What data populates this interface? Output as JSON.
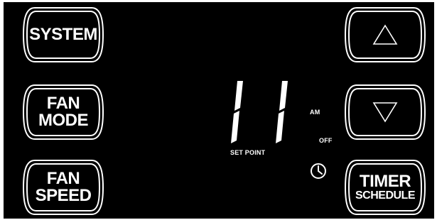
{
  "buttons": {
    "system": {
      "line1": "SYSTEM"
    },
    "fan_mode": {
      "line1": "FAN",
      "line2": "MODE"
    },
    "fan_speed": {
      "line1": "FAN",
      "line2": "SPEED"
    },
    "up": {
      "icon": "up-triangle-icon"
    },
    "down": {
      "icon": "down-triangle-icon"
    },
    "timer_schedule": {
      "line1": "TIMER",
      "line2": "SCHEDULE"
    }
  },
  "display": {
    "value": "11",
    "am_label": "AM",
    "off_label": "OFF",
    "setpoint_label": "SET POINT",
    "clock_icon": "clock-icon"
  },
  "colors": {
    "background": "#000000",
    "foreground": "#ffffff"
  }
}
